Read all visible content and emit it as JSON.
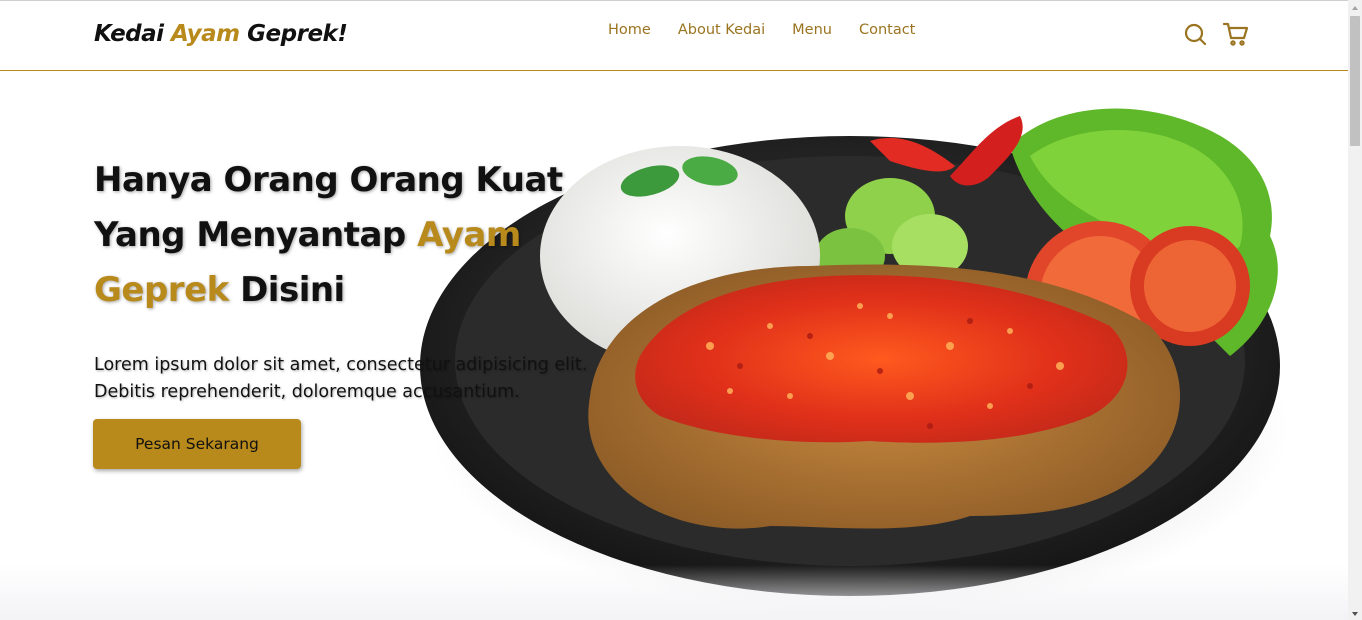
{
  "brand": {
    "name_part1": "Kedai ",
    "name_accent": "Ayam",
    "name_part2": " Geprek!"
  },
  "nav": {
    "links": [
      "Home",
      "About Kedai",
      "Menu",
      "Contact"
    ]
  },
  "icons": {
    "search": "search-icon",
    "cart": "cart-icon"
  },
  "hero": {
    "title_line1": "Hanya Orang Orang Kuat",
    "title_line2_prefix": "Yang Menyantap ",
    "title_line2_accent": "Ayam",
    "title_line3_accent": "Geprek",
    "title_line3_suffix": " Disini",
    "description": "Lorem ipsum dolor sit amet, consectetur adipisicing elit. Debitis reprehenderit, doloremque accusantium.",
    "cta_label": "Pesan Sekarang"
  },
  "colors": {
    "accent": "#b8891b",
    "text": "#111111",
    "nav_link": "#9a7420"
  }
}
